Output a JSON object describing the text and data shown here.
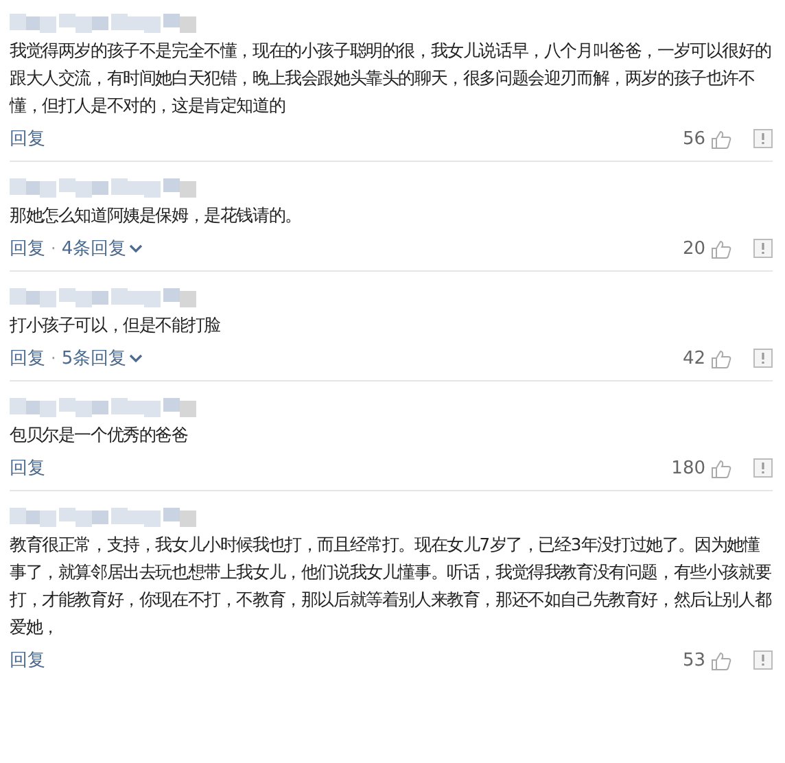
{
  "comments": [
    {
      "text": "我觉得两岁的孩子不是完全不懂，现在的小孩子聪明的很，我女儿说话早，八个月叫爸爸，一岁可以很好的跟大人交流，有时间她白天犯错，晚上我会跟她头靠头的聊天，很多问题会迎刃而解，两岁的孩子也许不懂，但打人是不对的，这是肯定知道的",
      "reply": "回复",
      "likes": "56"
    },
    {
      "text": "那她怎么知道阿姨是保姆，是花钱请的。",
      "reply": "回复",
      "separator": "·",
      "replies": "4条回复",
      "likes": "20"
    },
    {
      "text": "打小孩子可以，但是不能打脸",
      "reply": "回复",
      "separator": "·",
      "replies": "5条回复",
      "likes": "42"
    },
    {
      "text": "包贝尔是一个优秀的爸爸",
      "reply": "回复",
      "likes": "180"
    },
    {
      "text": "教育很正常，支持，我女儿小时候我也打，而且经常打。现在女儿7岁了，已经3年没打过她了。因为她懂事了，就算邻居出去玩也想带上我女儿，他们说我女儿懂事。听话，我觉得我教育没有问题，有些小孩就要打，才能教育好，你现在不打，不教育，那以后就等着别人来教育，那还不如自己先教育好，然后让别人都爱她，",
      "reply": "回复",
      "likes": "53"
    }
  ]
}
